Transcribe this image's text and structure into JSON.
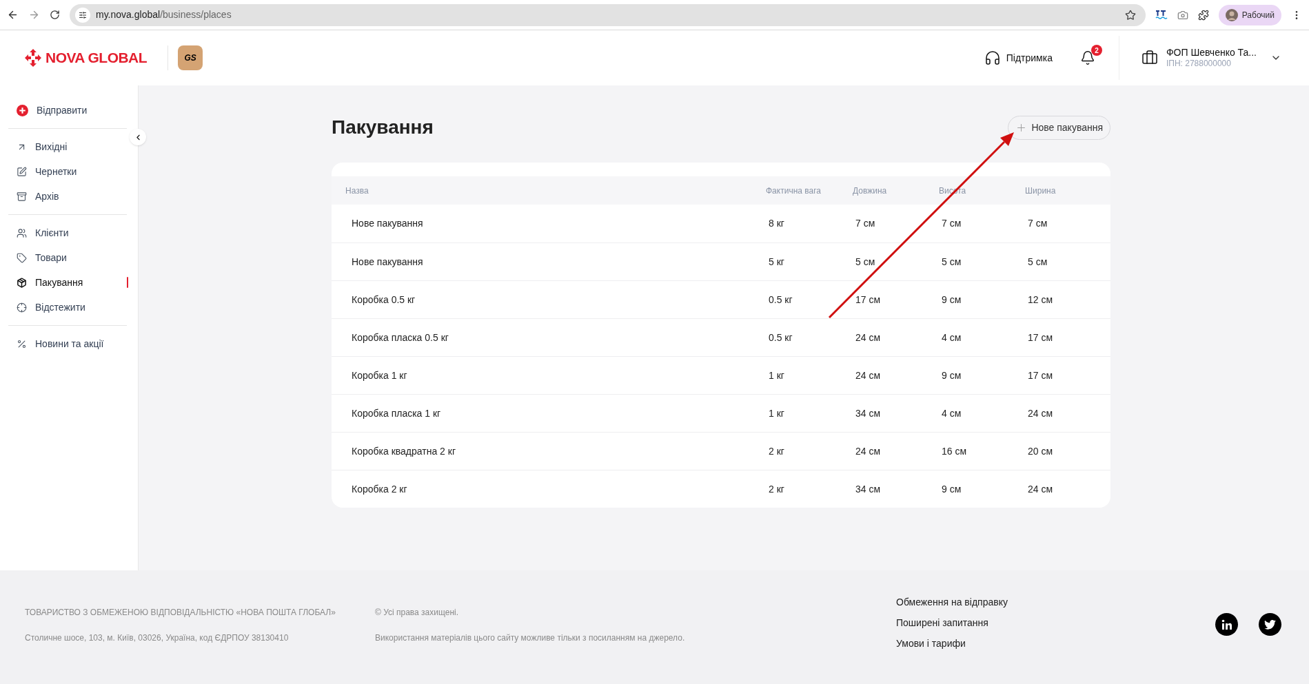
{
  "browser": {
    "url_host": "my.nova.global",
    "url_path": "/business/places",
    "profile_label": "Рабочий"
  },
  "header": {
    "brand": "NOVA GLOBAL",
    "badge": "GS",
    "support": "Підтримка",
    "notifications_count": "2",
    "account": {
      "name": "ФОП Шевченко Та...",
      "tax_id": "ІПН: 2788000000"
    }
  },
  "sidebar": {
    "groups": [
      [
        {
          "kind": "action",
          "label": "Відправити",
          "selected": false
        }
      ],
      [
        {
          "kind": "link",
          "label": "Вихідні",
          "selected": false
        },
        {
          "kind": "link",
          "label": "Чернетки",
          "selected": false
        },
        {
          "kind": "link",
          "label": "Архів",
          "selected": false
        }
      ],
      [
        {
          "kind": "link",
          "label": "Клієнти",
          "selected": false
        },
        {
          "kind": "link",
          "label": "Товари",
          "selected": false
        },
        {
          "kind": "link",
          "label": "Пакування",
          "selected": true
        },
        {
          "kind": "link",
          "label": "Відстежити",
          "selected": false
        }
      ],
      [
        {
          "kind": "link",
          "label": "Новини та акції",
          "selected": false
        }
      ]
    ]
  },
  "page": {
    "title": "Пакування",
    "new_button": "Нове пакування"
  },
  "table": {
    "columns": [
      "Назва",
      "Фактична вага",
      "Довжина",
      "Висота",
      "Ширина"
    ],
    "rows": [
      [
        "Нове пакування",
        "8 кг",
        "7 см",
        "7 см",
        "7 см"
      ],
      [
        "Нове пакування",
        "5 кг",
        "5 см",
        "5 см",
        "5 см"
      ],
      [
        "Коробка 0.5 кг",
        "0.5 кг",
        "17 см",
        "9 см",
        "12 см"
      ],
      [
        "Коробка пласка 0.5 кг",
        "0.5 кг",
        "24 см",
        "4 см",
        "17 см"
      ],
      [
        "Коробка 1 кг",
        "1 кг",
        "24 см",
        "9 см",
        "17 см"
      ],
      [
        "Коробка пласка 1 кг",
        "1 кг",
        "34 см",
        "4 см",
        "24 см"
      ],
      [
        "Коробка квадратна 2 кг",
        "2 кг",
        "24 см",
        "16 см",
        "20 см"
      ],
      [
        "Коробка 2 кг",
        "2 кг",
        "34 см",
        "9 см",
        "24 см"
      ]
    ]
  },
  "annotations": [
    {
      "kind": "arrow"
    }
  ],
  "footer": {
    "company": "ТОВАРИСТВО З ОБМЕЖЕНОЮ ВІДПОВІДАЛЬНІСТЮ «НОВА ПОШТА ГЛОБАЛ»",
    "address": "Столичне шосе, 103, м. Київ, 03026, Україна, код ЄДРПОУ 38130410",
    "copyright": "© Усі права захищені.",
    "usage_note": "Використання матеріалів цього сайту можливе тільки з посиланням на джерело.",
    "links": [
      "Обмеження на відправку",
      "Поширені запитання",
      "Умови і тарифи"
    ]
  }
}
